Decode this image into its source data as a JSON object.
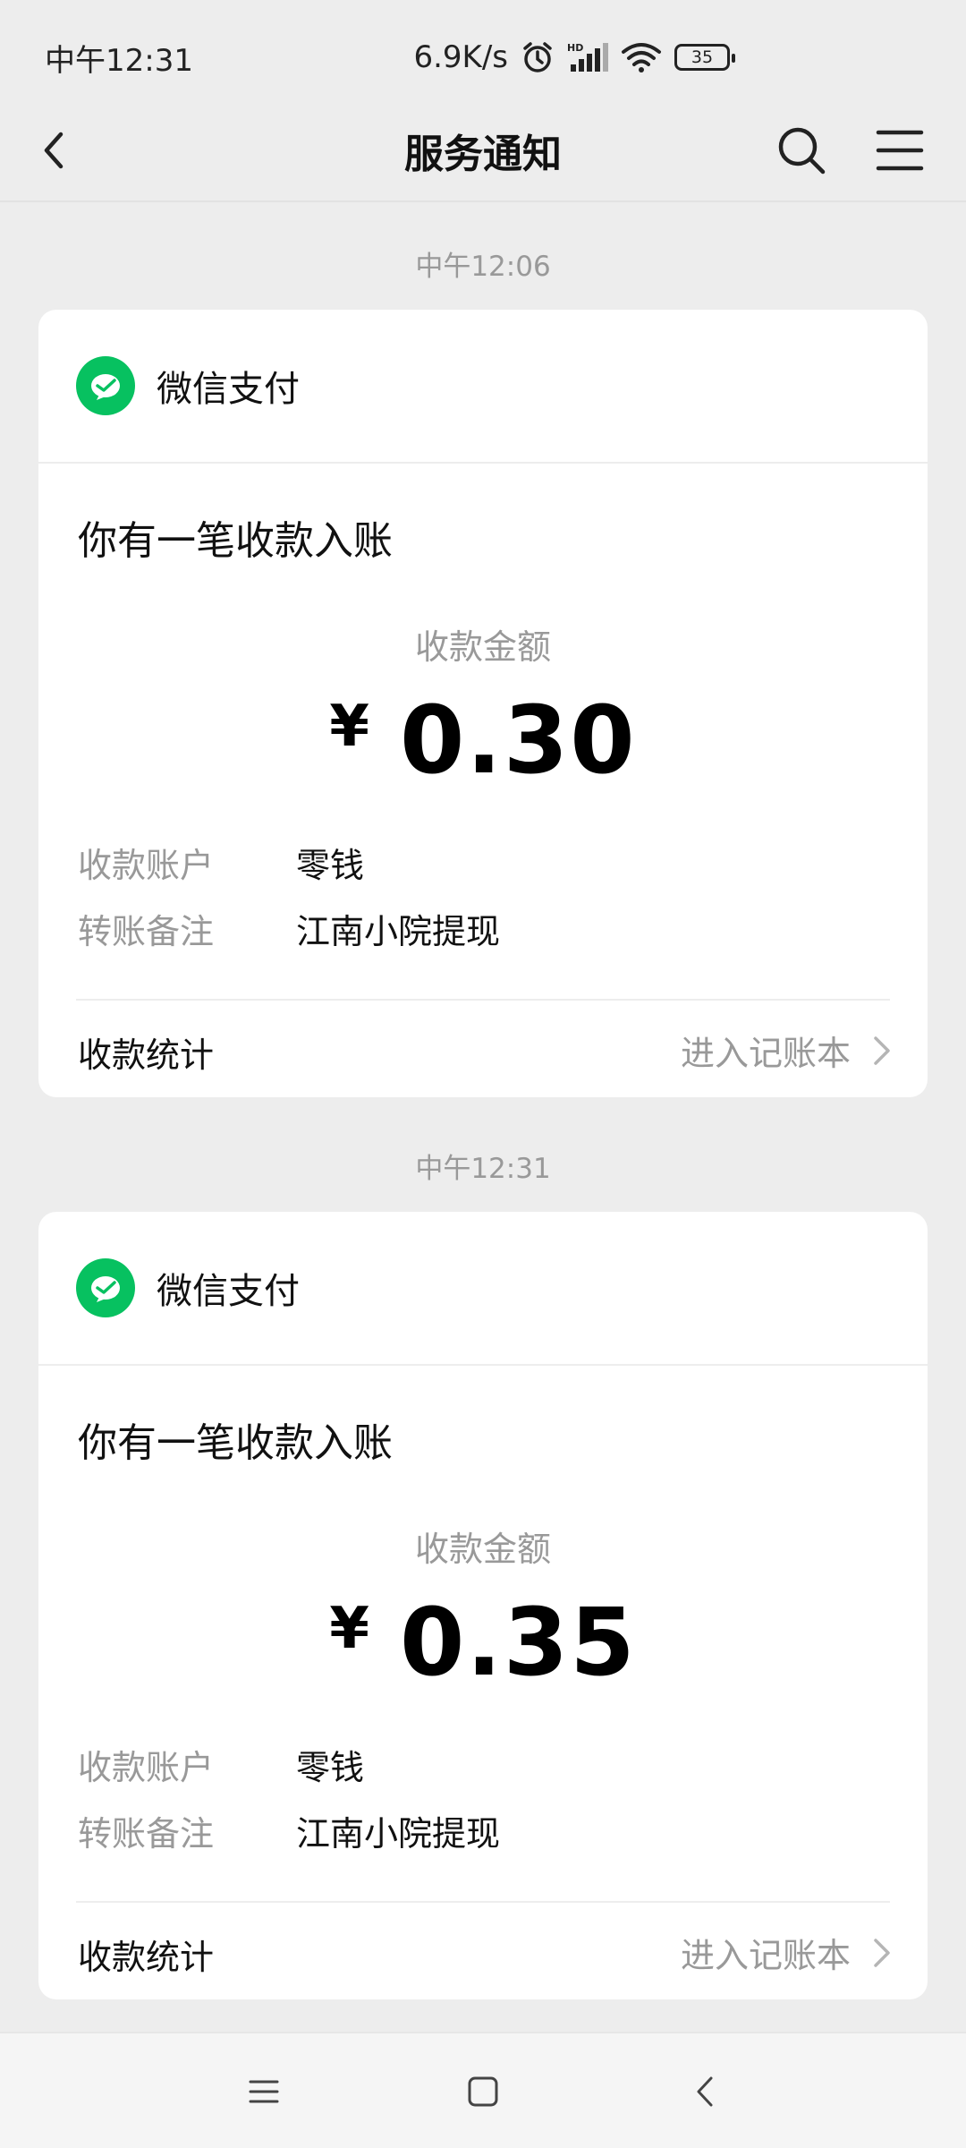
{
  "status_bar": {
    "time": "中午12:31",
    "speed": "6.9K/s",
    "battery": "35"
  },
  "nav": {
    "title": "服务通知"
  },
  "notifications": [
    {
      "time": "中午12:06",
      "source": "微信支付",
      "title": "你有一笔收款入账",
      "amount_label": "收款金额",
      "currency": "¥",
      "amount": "0.30",
      "rows": [
        {
          "k": "收款账户",
          "v": "零钱"
        },
        {
          "k": "转账备注",
          "v": "江南小院提现"
        }
      ],
      "footer_left": "收款统计",
      "footer_right": "进入记账本"
    },
    {
      "time": "中午12:31",
      "source": "微信支付",
      "title": "你有一笔收款入账",
      "amount_label": "收款金额",
      "currency": "¥",
      "amount": "0.35",
      "rows": [
        {
          "k": "收款账户",
          "v": "零钱"
        },
        {
          "k": "转账备注",
          "v": "江南小院提现"
        }
      ],
      "footer_left": "收款统计",
      "footer_right": "进入记账本"
    }
  ],
  "colors": {
    "wechat_green": "#07c160",
    "background": "#ededed"
  }
}
